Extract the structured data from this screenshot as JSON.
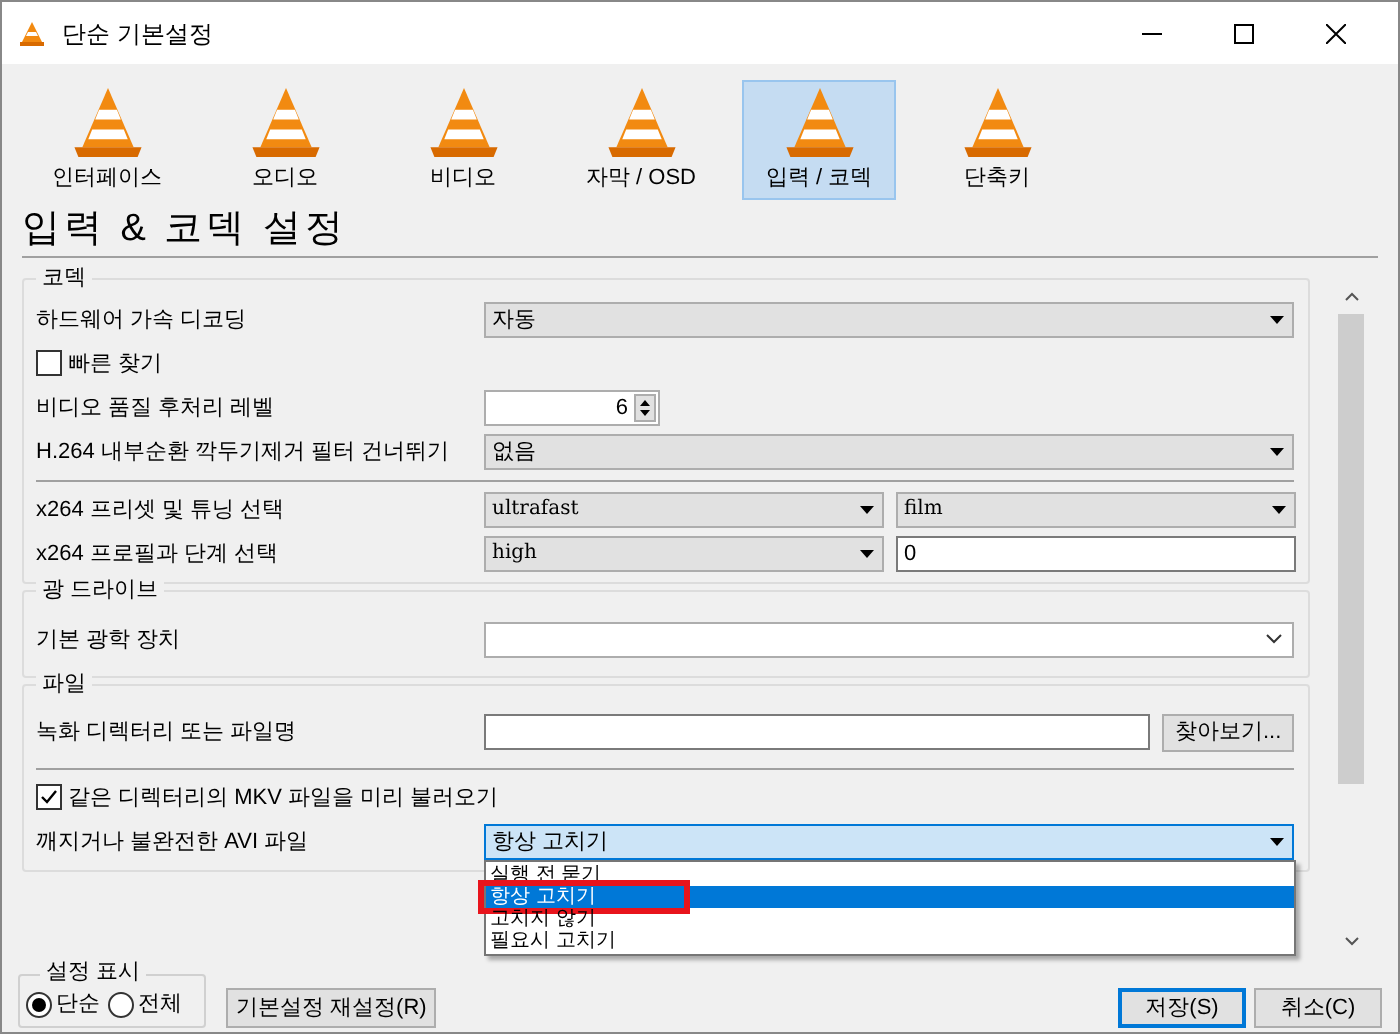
{
  "window": {
    "title": "단순 기본설정"
  },
  "categories": [
    {
      "label": "인터페이스",
      "selected": false
    },
    {
      "label": "오디오",
      "selected": false
    },
    {
      "label": "비디오",
      "selected": false
    },
    {
      "label": "자막 / OSD",
      "selected": false
    },
    {
      "label": "입력 / 코덱",
      "selected": true
    },
    {
      "label": "단축키",
      "selected": false
    }
  ],
  "heading": "입력 & 코덱 설정",
  "sections": [
    {
      "title": "코덱",
      "rows": [
        {
          "kind": "dropdown",
          "label": "하드웨어 가속 디코딩",
          "value": "자동"
        },
        {
          "kind": "checkbox",
          "label": "빠른 찾기",
          "checked": false
        },
        {
          "kind": "spinner",
          "label": "비디오 품질 후처리 레벨",
          "value": "6"
        },
        {
          "kind": "dropdown",
          "label": "H.264 내부순환 깍두기제거 필터 건너뛰기",
          "value": "없음"
        },
        {
          "kind": "separator"
        },
        {
          "kind": "pair",
          "label": "x264 프리셋 및 튜닝 선택",
          "fields": [
            {
              "kind": "dropdown",
              "value": "ultrafast"
            },
            {
              "kind": "dropdown",
              "value": "film"
            }
          ]
        },
        {
          "kind": "pair",
          "label": "x264 프로필과 단계 선택",
          "fields": [
            {
              "kind": "dropdown",
              "value": "high"
            },
            {
              "kind": "text",
              "value": "0"
            }
          ]
        }
      ]
    },
    {
      "title": "광 드라이브",
      "rows": [
        {
          "kind": "combo",
          "label": "기본 광학 장치"
        }
      ]
    },
    {
      "title": "파일",
      "rows": [
        {
          "kind": "path",
          "label": "녹화 디렉터리 또는 파일명",
          "button": "찾아보기..."
        },
        {
          "kind": "separator"
        },
        {
          "kind": "checkbox",
          "label": "같은 디렉터리의 MKV 파일을 미리 불러오기",
          "checked": true
        },
        {
          "kind": "dropdown",
          "label": "깨지거나 불완전한 AVI 파일",
          "value": "항상 고치기",
          "expanded": true,
          "options": [
            {
              "label": "실행 전 묻기",
              "selected": false,
              "marked": false
            },
            {
              "label": "항상 고치기",
              "selected": true,
              "marked": true
            },
            {
              "label": "고치지 않기",
              "selected": false,
              "marked": false
            },
            {
              "label": "필요시 고치기",
              "selected": false,
              "marked": false
            }
          ]
        }
      ]
    }
  ],
  "view_mode": {
    "title": "설정 표시",
    "options": [
      {
        "label": "단순",
        "selected": true
      },
      {
        "label": "전체",
        "selected": false
      }
    ]
  },
  "buttons": [
    {
      "label": "기본설정 재설정(R)",
      "default": false
    },
    {
      "label": "저장(S)",
      "default": true
    },
    {
      "label": "취소(C)",
      "default": false
    }
  ]
}
